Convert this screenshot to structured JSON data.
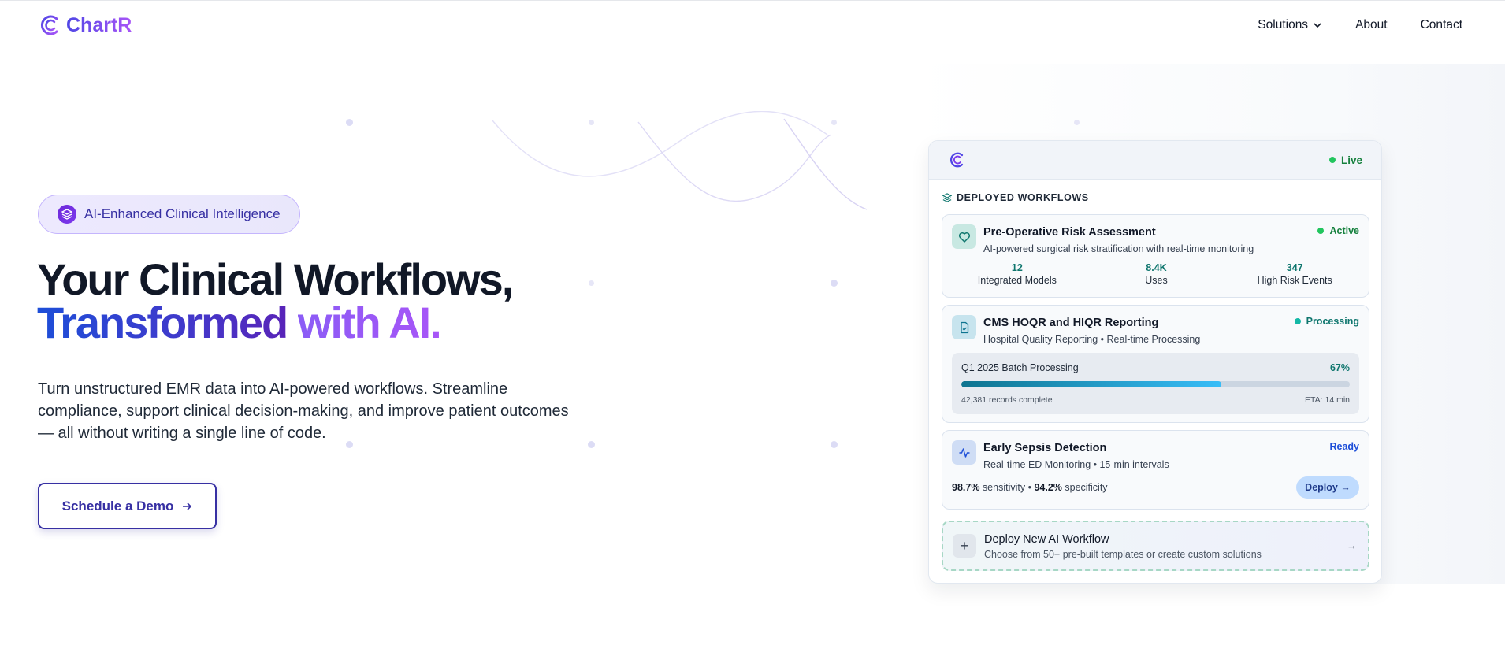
{
  "nav": {
    "brand": "ChartR",
    "links": [
      {
        "label": "Solutions",
        "has_dropdown": true
      },
      {
        "label": "About"
      },
      {
        "label": "Contact"
      }
    ]
  },
  "hero": {
    "badge": "AI-Enhanced Clinical Intelligence",
    "title_line1": "Your Clinical Workflows,",
    "title_line2_a": "Transformed ",
    "title_line2_b": "with AI.",
    "subtitle": "Turn unstructured EMR data into AI-powered workflows. Streamline compliance, support clinical decision-making, and improve patient outcomes — all without writing a single line of code.",
    "cta": "Schedule a Demo"
  },
  "panel": {
    "live_label": "Live",
    "section_title": "DEPLOYED WORKFLOWS",
    "cards": [
      {
        "title": "Pre-Operative Risk Assessment",
        "subtitle": "AI-powered surgical risk stratification with real-time monitoring",
        "status": "Active",
        "stats": [
          {
            "value": "12",
            "label": "Integrated Models"
          },
          {
            "value": "8.4K",
            "label": "Uses"
          },
          {
            "value": "347",
            "label": "High Risk Events"
          }
        ]
      },
      {
        "title": "CMS HOQR and HIQR Reporting",
        "subtitle": "Hospital Quality Reporting • Real-time Processing",
        "status": "Processing",
        "batch_label": "Q1 2025 Batch Processing",
        "batch_pct": "67%",
        "progress": 0.67,
        "records": "42,381 records complete",
        "eta": "ETA: 14 min"
      },
      {
        "title": "Early Sepsis Detection",
        "subtitle": "Real-time ED Monitoring • 15-min intervals",
        "status": "Ready",
        "sensitivity_value": "98.7%",
        "sensitivity_label": " sensitivity • ",
        "specificity_value": "94.2%",
        "specificity_label": " specificity",
        "deploy_label": "Deploy →"
      }
    ],
    "new_workflow": {
      "title": "Deploy New AI Workflow",
      "subtitle": "Choose from 50+ pre-built templates or create custom solutions",
      "plus": "+",
      "arrow": "→"
    }
  },
  "colors": {
    "accent": "#3730a3",
    "brand_gradient_start": "#4f46e5",
    "brand_gradient_end": "#a855f7",
    "active_green": "#22c55e",
    "processing_teal": "#14b8a6",
    "ready_blue": "#1d4ed8"
  }
}
